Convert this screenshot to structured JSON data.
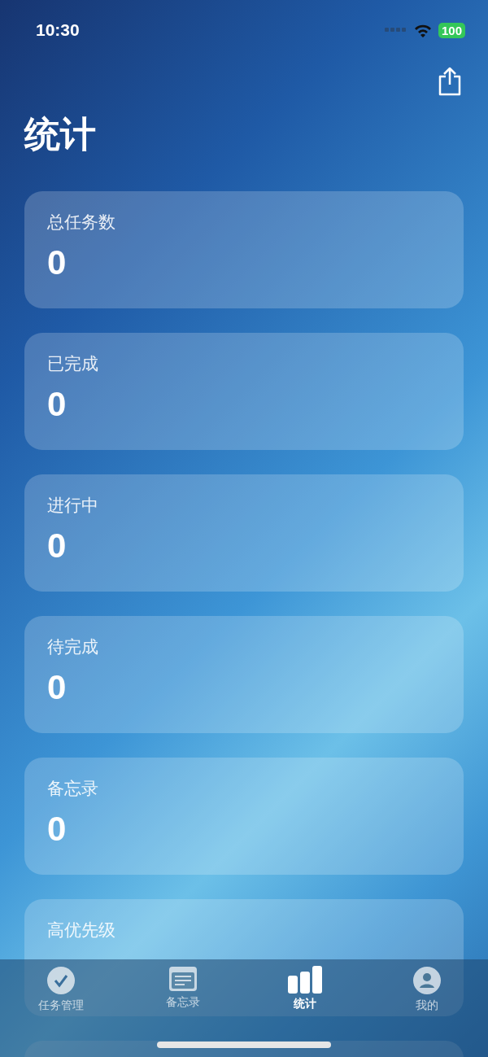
{
  "status_bar": {
    "time": "10:30",
    "battery": "100"
  },
  "title": "统计",
  "stats": [
    {
      "label": "总任务数",
      "value": "0"
    },
    {
      "label": "已完成",
      "value": "0"
    },
    {
      "label": "进行中",
      "value": "0"
    },
    {
      "label": "待完成",
      "value": "0"
    },
    {
      "label": "备忘录",
      "value": "0"
    },
    {
      "label": "高优先级"
    }
  ],
  "tabs": [
    {
      "kind": "tasks",
      "label": "任务管理",
      "selected": false
    },
    {
      "kind": "memo",
      "label": "备忘录",
      "selected": false
    },
    {
      "kind": "stats",
      "label": "统计",
      "selected": true
    },
    {
      "kind": "profile",
      "label": "我的",
      "selected": false
    }
  ]
}
